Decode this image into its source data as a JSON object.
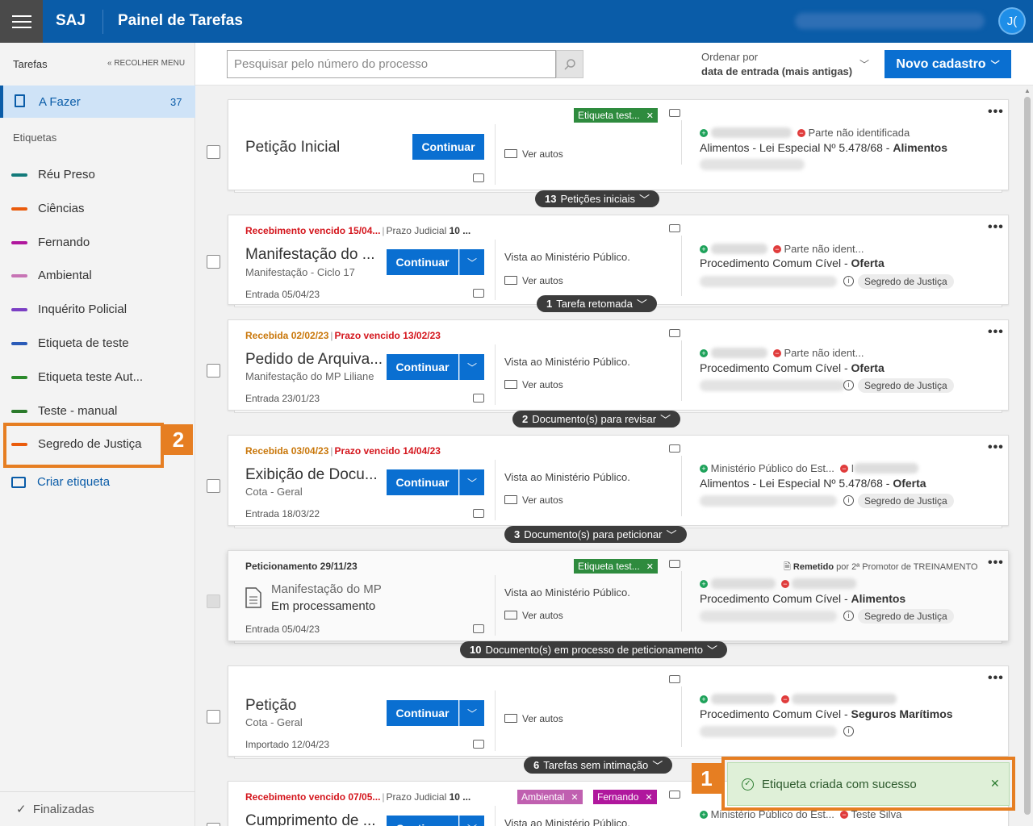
{
  "header": {
    "brand": "SAJ",
    "title": "Painel de Tarefas",
    "avatar": "J("
  },
  "sidebar": {
    "title": "Tarefas",
    "collapse": "« RECOLHER MENU",
    "active": {
      "label": "A Fazer",
      "count": "37"
    },
    "tags_title": "Etiquetas",
    "tags": [
      {
        "label": "Réu Preso",
        "color": "#127a7a"
      },
      {
        "label": "Ciências",
        "color": "#ea5b0c"
      },
      {
        "label": "Fernando",
        "color": "#b0179d"
      },
      {
        "label": "Ambiental",
        "color": "#c774b5"
      },
      {
        "label": "Inquérito Policial",
        "color": "#7b3fc4"
      },
      {
        "label": "Etiqueta de teste",
        "color": "#2a5bb8"
      },
      {
        "label": "Etiqueta teste Aut...",
        "color": "#2b8a2b"
      },
      {
        "label": "Teste - manual",
        "color": "#2b7a2b"
      },
      {
        "label": "Segredo de Justiça",
        "color": "#ea5b0c"
      }
    ],
    "create_tag": "Criar etiqueta",
    "finished": "Finalizadas"
  },
  "toolbar": {
    "search_placeholder": "Pesquisar pelo número do processo",
    "order_label": "Ordenar por",
    "order_value": "data de entrada (mais antigas)",
    "new_button": "Novo cadastro"
  },
  "common": {
    "continue": "Continuar",
    "ver_autos": "Ver autos",
    "vista": "Vista ao Ministério Público.",
    "segredo": "Segredo de Justiça"
  },
  "cards": [
    {
      "title": "Petição Inicial",
      "chip": "Etiqueta test...",
      "party_neg": "Parte não identificada",
      "classe": "Alimentos - Lei Especial Nº 5.478/68 - ",
      "classe_bold": "Alimentos",
      "pill_count": "13",
      "pill_label": "Petições iniciais"
    },
    {
      "head_a": "Recebimento vencido 15/04...",
      "head_b": "Prazo Judicial",
      "head_c": "10 ...",
      "title": "Manifestação do ...",
      "sub": "Manifestação - Ciclo 17",
      "entry": "Entrada 05/04/23",
      "party_neg": "Parte não ident...",
      "classe": "Procedimento Comum Cível - ",
      "classe_bold": "Oferta",
      "pill_count": "1",
      "pill_label": "Tarefa retomada"
    },
    {
      "head_a": "Recebida 02/02/23",
      "head_b": "Prazo vencido 13/02/23",
      "title": "Pedido de Arquiva...",
      "sub": "Manifestação do MP Liliane",
      "entry": "Entrada 23/01/23",
      "party_neg": "Parte não ident...",
      "classe": "Procedimento Comum Cível - ",
      "classe_bold": "Oferta",
      "pill_count": "2",
      "pill_label": "Documento(s) para revisar"
    },
    {
      "head_a": "Recebida 03/04/23",
      "head_b": "Prazo vencido 14/04/23",
      "title": "Exibição de Docu...",
      "sub": "Cota - Geral",
      "entry": "Entrada 18/03/22",
      "party_pos": "Ministério Público do Est...",
      "party_neg": "I",
      "classe": "Alimentos - Lei Especial Nº 5.478/68 - ",
      "classe_bold": "Oferta",
      "pill_count": "3",
      "pill_label": "Documento(s) para peticionar"
    },
    {
      "head_a": "Peticionamento 29/11/23",
      "chip": "Etiqueta test...",
      "remetido": "Remetido",
      "remetido_by": "por 2ª Promotor de TREINAMENTO",
      "doc": "Manifestação do MP",
      "status": "Em processamento",
      "entry": "Entrada 05/04/23",
      "classe": "Procedimento Comum Cível - ",
      "classe_bold": "Alimentos",
      "pill_count": "10",
      "pill_label": "Documento(s) em processo de peticionamento"
    },
    {
      "title": "Petição",
      "sub": "Cota - Geral",
      "entry": "Importado 12/04/23",
      "classe": "Procedimento Comum Cível - ",
      "classe_bold": "Seguros Marítimos",
      "pill_count": "6",
      "pill_label": "Tarefas sem intimação"
    },
    {
      "head_a": "Recebimento vencido 07/05...",
      "head_b": "Prazo Judicial",
      "head_c": "10 ...",
      "title": "Cumprimento de ...",
      "chip_a": "Ambiental",
      "chip_b": "Fernando",
      "party_pos": "Ministério Público do Est...",
      "party_neg": "Teste Silva"
    }
  ],
  "toast": {
    "message": "Etiqueta criada com sucesso"
  },
  "annotations": {
    "one": "1",
    "two": "2"
  },
  "colors": {
    "primary": "#0a5ca8",
    "accent": "#e67e22",
    "green_chip": "#2e8b3e",
    "ambiental": "#c060b0",
    "fernando": "#b0179d"
  }
}
